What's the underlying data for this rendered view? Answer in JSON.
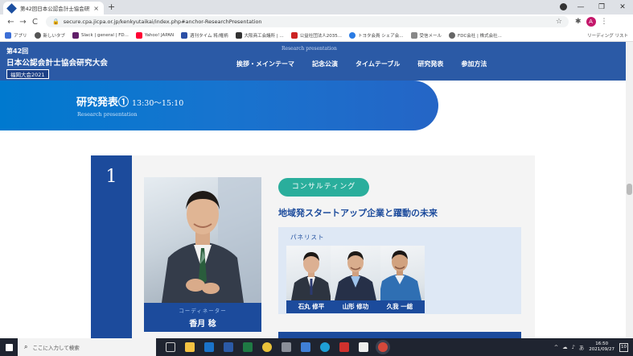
{
  "browser": {
    "tab_title": "第42回日本公認会計士協会研究大会",
    "tab_close": "×",
    "new_tab": "+",
    "window_controls": [
      "—",
      "❐",
      "✕"
    ],
    "back": "←",
    "forward": "→",
    "reload": "C",
    "url": "secure.cpa.jicpa.or.jp/kenkyutaikai/index.php#anchor-ResearchPresentation",
    "avatar_letter": "A"
  },
  "bookmarks": [
    {
      "label": "アプリ",
      "color": "#3c6fd6"
    },
    {
      "label": "新しいタブ",
      "color": "#555555"
    },
    {
      "label": "Slack | general | FD...",
      "color": "#611f69"
    },
    {
      "label": "Yahoo! JAPAN",
      "color": "#ff0033"
    },
    {
      "label": "週刊タイム 将/権柄",
      "color": "#2b4fa6"
    },
    {
      "label": "大阪商工会議所 | ...",
      "color": "#333333"
    },
    {
      "label": "公益社団法人2035...",
      "color": "#cc2222"
    },
    {
      "label": "トヨタ会員 シェア会...",
      "color": "#2a7be4"
    },
    {
      "label": "受信メール",
      "color": "#888888"
    },
    {
      "label": "FDC会社 | 株式会社...",
      "color": "#666666"
    }
  ],
  "bookmarks_right": "リーディング リスト",
  "site": {
    "logo_line1": "第42回",
    "logo_line2": "日本公認会計士協会研究大会",
    "logo_line3": "福岡大会2021",
    "sub_en": "Research presentation",
    "nav": [
      "挨拶・メインテーマ",
      "記念公演",
      "タイムテーブル",
      "研究発表",
      "参加方法"
    ]
  },
  "section": {
    "title": "研究発表①",
    "time": "13:30〜15:10",
    "en": "Research presentation"
  },
  "presentation": {
    "number": "1",
    "coordinator_role": "コーディネーター",
    "coordinator_name": "香月 稔",
    "category": "コンサルティング",
    "title": "地域発スタートアップ企業と躍動の未来",
    "panel_label": "パネリスト",
    "panelists": [
      {
        "name": "石丸 修平"
      },
      {
        "name": "山形 修功"
      },
      {
        "name": "久我 一総"
      }
    ]
  },
  "taskbar": {
    "search_placeholder": "ここに入力して検索",
    "time": "16:50",
    "date": "2021/09/27",
    "notifications": "10",
    "tray_symbols": [
      "^",
      "☁",
      "♪",
      "あ"
    ]
  },
  "colors": {
    "header": "#2b5aa6",
    "accent_navy": "#1c4b9c",
    "category_teal": "#2aae9c"
  }
}
